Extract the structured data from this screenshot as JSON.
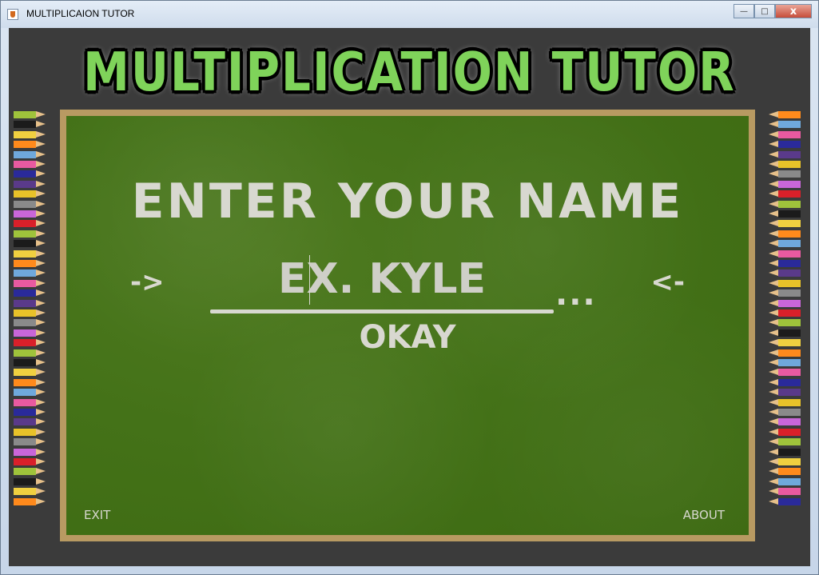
{
  "window": {
    "title": "MULTIPLICAION TUTOR",
    "minimize_label": "—",
    "maximize_label": "□",
    "close_label": "x"
  },
  "game": {
    "title": "MULTIPLICATION TUTOR",
    "heading": "ENTER YOUR NAME",
    "name_placeholder": "EX. KYLE",
    "arrow_left": "->",
    "arrow_right": "<-",
    "ellipsis": "...",
    "okay_label": "OKAY",
    "exit_label": "EXIT",
    "about_label": "ABOUT"
  },
  "colors": {
    "chalkboard": "#447218",
    "frame": "#b89a62",
    "chalk": "#d8d8d0",
    "title_green": "#7fd35a",
    "background": "#3b3b3b"
  }
}
